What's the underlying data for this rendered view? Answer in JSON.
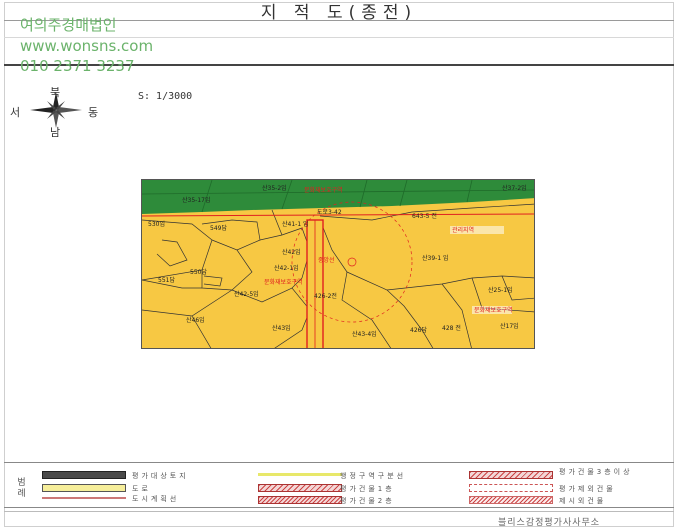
{
  "header": {
    "title": "지 적 도(종전)"
  },
  "watermark": {
    "company": "여의주경매법인",
    "website": "www.wonsns.com",
    "phone": "010 2371 3237"
  },
  "scale": {
    "label": "S:  1/3000"
  },
  "compass": {
    "north": "북",
    "south": "남",
    "east": "동",
    "west": "서"
  },
  "map": {
    "labels": [
      "산35-2임",
      "산35-17임",
      "산37-2임",
      "도로3-42",
      "643-5 전",
      "산41-1 임",
      "530임",
      "549답",
      "산42임",
      "산42-1임",
      "550답",
      "551답",
      "산42-5임",
      "산46임",
      "산43임",
      "산39-1 임",
      "426-2전",
      "산43-4임",
      "426답",
      "428 전",
      "산17임",
      "산25-1임"
    ],
    "red_labels": [
      "문화재보호구역",
      "관리지역",
      "문화재보호구역",
      "중앙선",
      "문화재보호구역"
    ],
    "colors": {
      "forest": "#2e8b3a",
      "land": "#f7c843",
      "boundary": "#333333",
      "highlight": "#e02020"
    }
  },
  "legend": {
    "title": "범례",
    "items": [
      "평가대상토지",
      "도로",
      "도시계획선",
      "행정구역구분선",
      "평가건물1층",
      "평가건물2층",
      "평가건물3층이상",
      "평가제외건물",
      "제시외건물"
    ],
    "colors": {
      "subject": "#4a4a4a",
      "road": "#f6ee9a",
      "plan": "#c77",
      "admin": "#e8e86a"
    }
  },
  "footer": {
    "office": "블리스감정평가사사무소"
  }
}
